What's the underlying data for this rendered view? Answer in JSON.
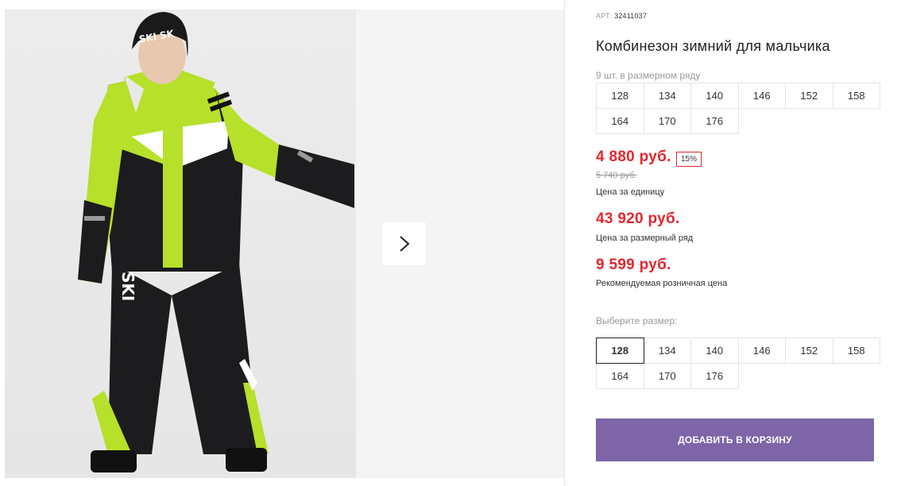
{
  "product": {
    "art_label": "АРТ:",
    "art_value": "32411037",
    "title": "Комбинезон зимний для мальчика",
    "sizes_note": "9 шт. в размерном ряду",
    "size_range": [
      "128",
      "134",
      "140",
      "146",
      "152",
      "158",
      "164",
      "170",
      "176"
    ],
    "price_unit": "4 880 руб.",
    "discount": "15%",
    "old_price": "5 740 руб.",
    "price_unit_caption": "Цена за единицу",
    "price_range": "43 920 руб.",
    "price_range_caption": "Цена за размерный ряд",
    "price_retail": "9 599 руб.",
    "price_retail_caption": "Рекомендуемая розничная цена",
    "choose_size_label": "Выберите размер:",
    "size_options": [
      "128",
      "134",
      "140",
      "146",
      "152",
      "158",
      "164",
      "170",
      "176"
    ],
    "selected_size": "128",
    "add_to_cart": "ДОБАВИТЬ В КОРЗИНУ"
  },
  "gallery": {
    "next_icon": "chevron-right-icon",
    "print_text": "SKI"
  },
  "colors": {
    "price": "#e0282e",
    "button": "#7d65a8",
    "lime": "#b6e02a"
  }
}
